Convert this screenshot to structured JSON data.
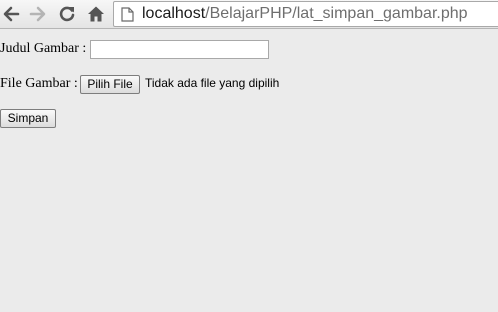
{
  "browser": {
    "url_host": "localhost",
    "url_path": "/BelajarPHP/lat_simpan_gambar.php",
    "icons": {
      "back": "arrow-left-icon",
      "forward": "arrow-right-icon",
      "reload": "reload-icon",
      "home": "home-icon",
      "page": "page-icon"
    }
  },
  "form": {
    "judul_label": "Judul Gambar :",
    "judul_value": "",
    "file_label": "File Gambar :",
    "file_button": "Pilih File",
    "file_status": "Tidak ada file yang dipilih",
    "submit_label": "Simpan"
  }
}
